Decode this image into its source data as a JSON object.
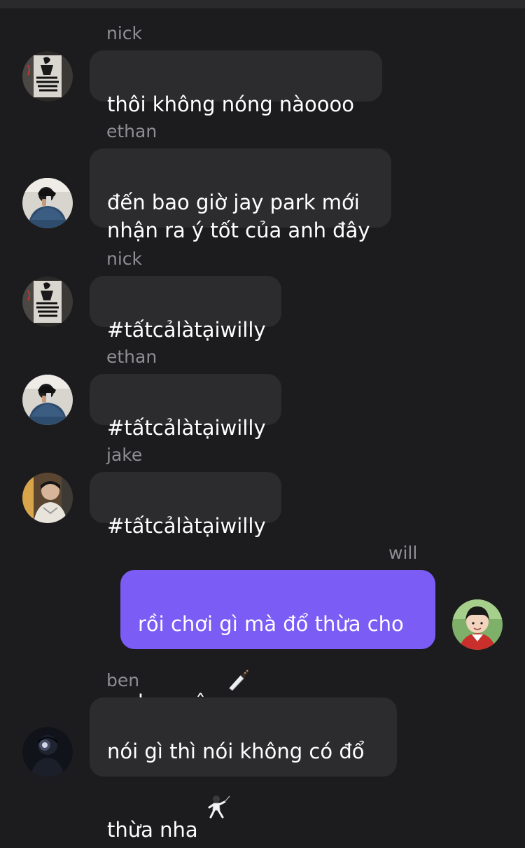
{
  "theme": {
    "background": "#1c1c1e",
    "incoming_bubble": "#2c2c2e",
    "outgoing_bubble": "#7b5cf5",
    "sender_text": "#8e8e93",
    "message_text": "#ffffff"
  },
  "messages": [
    {
      "sender": "nick",
      "text": "thôi không nóng nàoooo",
      "outgoing": false,
      "avatar_icon": "graffiti-avatar-icon"
    },
    {
      "sender": "ethan",
      "text": "đến bao giờ jay park mới\nnhận ra ý tốt của anh đây",
      "outgoing": false,
      "avatar_icon": "mirror-selfie-avatar-icon"
    },
    {
      "sender": "nick",
      "text": "#tấtcảlàtạiwilly",
      "outgoing": false,
      "avatar_icon": "graffiti-avatar-icon"
    },
    {
      "sender": "ethan",
      "text": "#tấtcảlàtạiwilly",
      "outgoing": false,
      "avatar_icon": "mirror-selfie-avatar-icon"
    },
    {
      "sender": "jake",
      "text": "#tấtcảlàtạiwilly",
      "outgoing": false,
      "avatar_icon": "portrait-avatar-icon"
    },
    {
      "sender": "will",
      "text": "rồi chơi gì mà đổ thừa cho\nbạn vậy ",
      "emoji": "kitchen-knife-emoji-icon",
      "outgoing": true,
      "avatar_icon": "child-photo-avatar-icon"
    },
    {
      "sender": "ben",
      "text": "nói gì thì nói không có đổ\nthừa nha ",
      "emoji": "fencing-emoji-icon",
      "outgoing": false,
      "avatar_icon": "dark-portrait-avatar-icon"
    }
  ]
}
